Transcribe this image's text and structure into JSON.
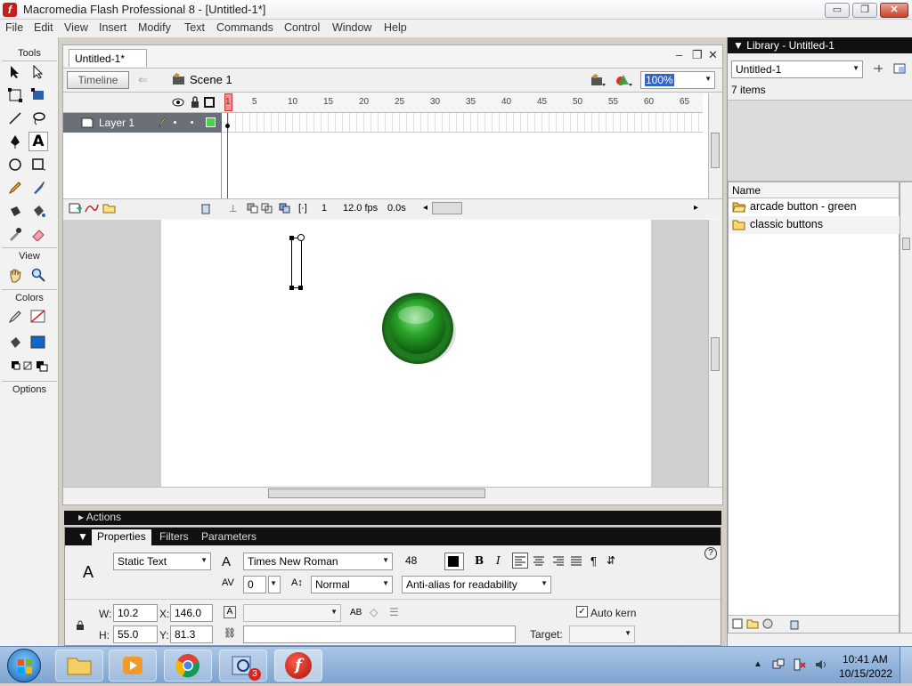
{
  "window": {
    "title": "Macromedia Flash Professional 8 - [Untitled-1*]",
    "logo": "f"
  },
  "window_buttons": {
    "minimize": "▭",
    "restore": "❐",
    "close": "✕"
  },
  "menu": [
    "File",
    "Edit",
    "View",
    "Insert",
    "Modify",
    "Text",
    "Commands",
    "Control",
    "Window",
    "Help"
  ],
  "tools": {
    "header": "Tools",
    "view_label": "View",
    "colors_label": "Colors",
    "options_label": "Options"
  },
  "document": {
    "tab": "Untitled-1*",
    "doc_controls": {
      "min": "–",
      "restore": "❐",
      "close": "✕"
    },
    "timeline_button": "Timeline",
    "scene": "Scene 1",
    "zoom": "100%",
    "layer_name": "Layer 1",
    "ruler_ticks": [
      "1",
      "5",
      "10",
      "15",
      "20",
      "25",
      "30",
      "35",
      "40",
      "45",
      "50",
      "55",
      "60",
      "65"
    ],
    "current_frame": "1",
    "fps": "12.0 fps",
    "elapsed": "0.0s"
  },
  "actions_panel": {
    "label": "Actions"
  },
  "properties": {
    "tabs": [
      "Properties",
      "Filters",
      "Parameters"
    ],
    "text_type": "Static Text",
    "font": "Times New Roman",
    "font_size": "48",
    "letter_spacing": "0",
    "position": "Normal",
    "anti_alias": "Anti-alias for readability",
    "w_label": "W:",
    "w": "10.2",
    "x_label": "X:",
    "x": "146.0",
    "h_label": "H:",
    "h": "55.0",
    "y_label": "Y:",
    "y": "81.3",
    "auto_kern": "Auto kern",
    "target_label": "Target:",
    "bold": "B",
    "italic": "I"
  },
  "library": {
    "header": "Library - Untitled-1",
    "doc_select": "Untitled-1",
    "count": "7 items",
    "column": "Name",
    "items": [
      {
        "name": "arcade button - green",
        "icon": "folder-open-icon"
      },
      {
        "name": "classic buttons",
        "icon": "folder-icon"
      }
    ]
  },
  "taskbar": {
    "time": "10:41 AM",
    "date": "10/15/2022",
    "badge": "3"
  }
}
